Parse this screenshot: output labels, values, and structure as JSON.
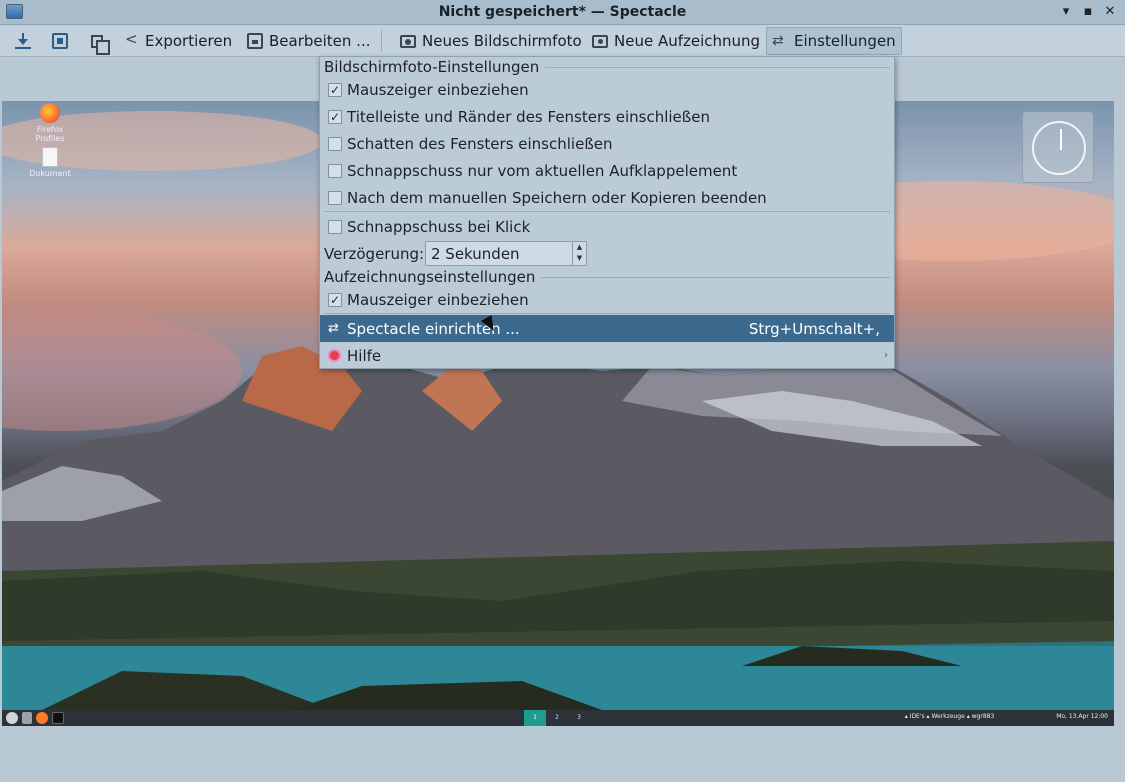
{
  "window": {
    "title": "Nicht gespeichert* — Spectacle",
    "minimize": "▾",
    "maximize": "▪",
    "close": "✕"
  },
  "toolbar": {
    "export": "Exportieren",
    "edit": "Bearbeiten ...",
    "new_screenshot": "Neues Bildschirmfoto",
    "new_recording": "Neue Aufzeichnung",
    "settings": "Einstellungen"
  },
  "menu": {
    "screenshot_section": "Bildschirmfoto-Einstellungen",
    "screenshot_options": [
      {
        "label": "Mauszeiger einbeziehen",
        "checked": true,
        "mark": "✓"
      },
      {
        "label": "Titelleiste und Ränder des Fensters einschließen",
        "checked": true,
        "mark": "✓"
      },
      {
        "label": "Schatten des Fensters einschließen",
        "checked": false,
        "mark": ""
      },
      {
        "label": "Schnappschuss nur vom aktuellen Aufklappelement",
        "checked": false,
        "mark": ""
      },
      {
        "label": "Nach dem manuellen Speichern oder Kopieren beenden",
        "checked": false,
        "mark": ""
      }
    ],
    "click_snapshot": {
      "label": "Schnappschuss bei Klick",
      "checked": false,
      "mark": ""
    },
    "delay_label": "Verzögerung:",
    "delay_value": "2 Sekunden",
    "recording_section": "Aufzeichnungseinstellungen",
    "recording_option": {
      "label": "Mauszeiger einbeziehen",
      "checked": true,
      "mark": "✓"
    },
    "configure": {
      "label": "Spectacle einrichten ...",
      "shortcut": "Strg+Umschalt+,"
    },
    "help": {
      "label": "Hilfe",
      "arrow": "›"
    }
  },
  "desktop": {
    "icons": [
      {
        "label": "Firefox Profiles"
      },
      {
        "label": "Dokument"
      }
    ],
    "pager": [
      "1",
      "2",
      "3"
    ],
    "tray_text": "▴ IDE's ▴ Werkzeuge ▴ wgr883",
    "clock_text": "Mo, 13.Apr 12:00"
  },
  "colors": {
    "accent": "#3c6a8e",
    "pager_active": "#1e9d8f"
  }
}
